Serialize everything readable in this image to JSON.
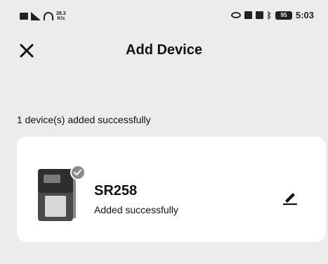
{
  "status_bar": {
    "net_speed_value": "28.3",
    "net_speed_unit": "K/s",
    "time": "5:03",
    "battery_level": "95",
    "icons": [
      "notification-icon",
      "signal-icon",
      "wifi-icon",
      "eye-icon",
      "sim-icon",
      "vibrate-icon",
      "bluetooth-icon",
      "battery-icon"
    ]
  },
  "header": {
    "title": "Add Device",
    "close_icon": "close-icon"
  },
  "message": "1 device(s) added successfully",
  "device": {
    "name": "SR258",
    "status": "Added successfully",
    "image_icon": "controller-device-icon",
    "badge_icon": "check-badge-icon",
    "edit_icon": "pencil-icon"
  }
}
